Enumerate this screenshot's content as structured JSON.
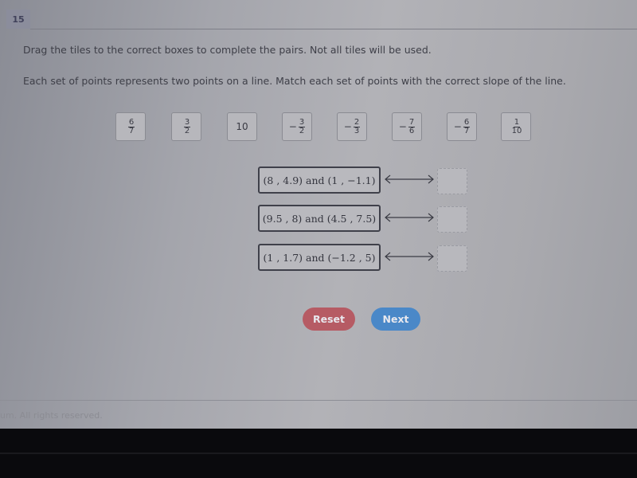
{
  "question": {
    "number": "15",
    "instruction_1": "Drag the tiles to the correct boxes to complete the pairs. Not all tiles will be used.",
    "instruction_2": "Each set of points represents two points on a line. Match each set of points with the correct slope of the line."
  },
  "tiles": [
    {
      "sign": "",
      "num": "6",
      "den": "7",
      "label": "6/7"
    },
    {
      "sign": "",
      "num": "3",
      "den": "2",
      "label": "3/2"
    },
    {
      "whole": "10",
      "label": "10"
    },
    {
      "sign": "−",
      "num": "3",
      "den": "2",
      "label": "−3/2"
    },
    {
      "sign": "−",
      "num": "2",
      "den": "3",
      "label": "−2/3"
    },
    {
      "sign": "−",
      "num": "7",
      "den": "6",
      "label": "−7/6"
    },
    {
      "sign": "−",
      "num": "6",
      "den": "7",
      "label": "−6/7"
    },
    {
      "sign": "",
      "num": "1",
      "den": "10",
      "label": "1/10"
    }
  ],
  "pairs": [
    {
      "points": "(8 , 4.9) and (1 , −1.1)",
      "answer": ""
    },
    {
      "points": "(9.5 , 8) and (4.5 , 7.5)",
      "answer": ""
    },
    {
      "points": "(1 , 1.7) and (−1.2 , 5)",
      "answer": ""
    }
  ],
  "icons": {
    "pair_connector": "double-arrow-icon"
  },
  "buttons": {
    "reset": "Reset",
    "next": "Next"
  },
  "colors": {
    "reset": "#b65b64",
    "next": "#4a88c8"
  },
  "footer": {
    "copyright": "um. All rights reserved."
  }
}
